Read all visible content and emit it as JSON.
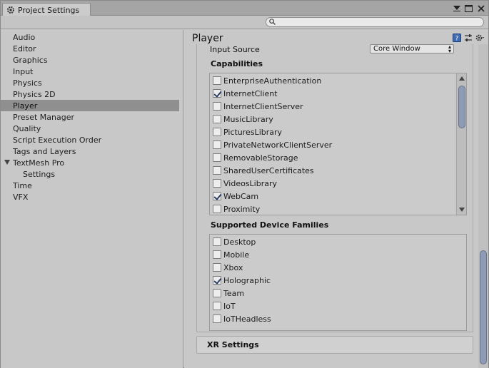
{
  "window": {
    "tab_title": "Project Settings",
    "icons": [
      "gear-icon",
      "menu-icon",
      "maximize-icon",
      "close-icon"
    ]
  },
  "search": {
    "placeholder": "",
    "value": ""
  },
  "sidebar": {
    "items": [
      {
        "label": "Audio"
      },
      {
        "label": "Editor"
      },
      {
        "label": "Graphics"
      },
      {
        "label": "Input"
      },
      {
        "label": "Physics"
      },
      {
        "label": "Physics 2D"
      },
      {
        "label": "Player",
        "selected": true
      },
      {
        "label": "Preset Manager"
      },
      {
        "label": "Quality"
      },
      {
        "label": "Script Execution Order"
      },
      {
        "label": "Tags and Layers"
      },
      {
        "label": "TextMesh Pro",
        "expanded": true
      },
      {
        "label": "Settings",
        "child": true
      },
      {
        "label": "Time"
      },
      {
        "label": "VFX"
      }
    ]
  },
  "main": {
    "title": "Player",
    "input_source": {
      "label": "Input Source",
      "value": "Core Window"
    },
    "capabilities": {
      "title": "Capabilities",
      "items": [
        {
          "label": "EnterpriseAuthentication",
          "checked": false
        },
        {
          "label": "InternetClient",
          "checked": true
        },
        {
          "label": "InternetClientServer",
          "checked": false
        },
        {
          "label": "MusicLibrary",
          "checked": false
        },
        {
          "label": "PicturesLibrary",
          "checked": false
        },
        {
          "label": "PrivateNetworkClientServer",
          "checked": false
        },
        {
          "label": "RemovableStorage",
          "checked": false
        },
        {
          "label": "SharedUserCertificates",
          "checked": false
        },
        {
          "label": "VideosLibrary",
          "checked": false
        },
        {
          "label": "WebCam",
          "checked": true
        },
        {
          "label": "Proximity",
          "checked": false
        }
      ]
    },
    "device_families": {
      "title": "Supported Device Families",
      "items": [
        {
          "label": "Desktop",
          "checked": false
        },
        {
          "label": "Mobile",
          "checked": false
        },
        {
          "label": "Xbox",
          "checked": false
        },
        {
          "label": "Holographic",
          "checked": true
        },
        {
          "label": "Team",
          "checked": false
        },
        {
          "label": "IoT",
          "checked": false
        },
        {
          "label": "IoTHeadless",
          "checked": false
        }
      ]
    },
    "xr_settings": {
      "label": "XR Settings"
    }
  }
}
